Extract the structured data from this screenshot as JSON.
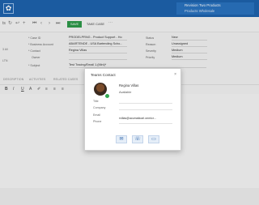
{
  "topbar": {
    "logo_glyph": "✿",
    "tenant_line1": "Revision Two Products",
    "tenant_line2": "Products Wholesale"
  },
  "toolbar": {
    "page_label": "ts",
    "icons": [
      "↻",
      "↩",
      "+",
      "⏮",
      "‹",
      "›",
      "⏭"
    ],
    "save_label": "SAVE",
    "take_case_label": "TAKE CASE",
    "more": "···"
  },
  "form": {
    "left_side": [
      "3 All",
      "LTN"
    ],
    "rows": [
      {
        "label": "* Case ID",
        "value": "PRODELPRNG - Product Support - Ho..."
      },
      {
        "label": "* Business Account",
        "value": "ABARTENDE - USA Bartending Scho..."
      },
      {
        "label": "* Contact",
        "value": "Regina Villas"
      },
      {
        "label": "Owner",
        "value": ""
      },
      {
        "label": "* Subject",
        "value": "Test Tracing/Email 1.(Mini)*"
      }
    ],
    "right_rows": [
      {
        "label": "Status",
        "value": "New"
      },
      {
        "label": "Reason",
        "value": "Unassigned"
      },
      {
        "label": "Severity",
        "value": "Medium"
      },
      {
        "label": "Priority",
        "value": "Medium"
      }
    ]
  },
  "tabs": [
    "DESCRIPTION",
    "ACTIVITIES",
    "RELATED CASES"
  ],
  "editor_tools": [
    "B",
    "I",
    "U",
    "A",
    "✐",
    "≡",
    "≡",
    "≡"
  ],
  "teams_card": {
    "title": "Teams Contact",
    "close": "×",
    "name": "Regina Villas",
    "status": "Available",
    "fields": [
      "Title",
      "Company",
      "Email",
      "Phone"
    ],
    "email": "rvillas@acumaticarl.onmicr...",
    "actions": [
      {
        "icon": "chat-icon",
        "glyph": "✉"
      },
      {
        "icon": "phone-icon",
        "glyph": "☏"
      },
      {
        "icon": "video-icon",
        "glyph": "▭"
      }
    ]
  }
}
